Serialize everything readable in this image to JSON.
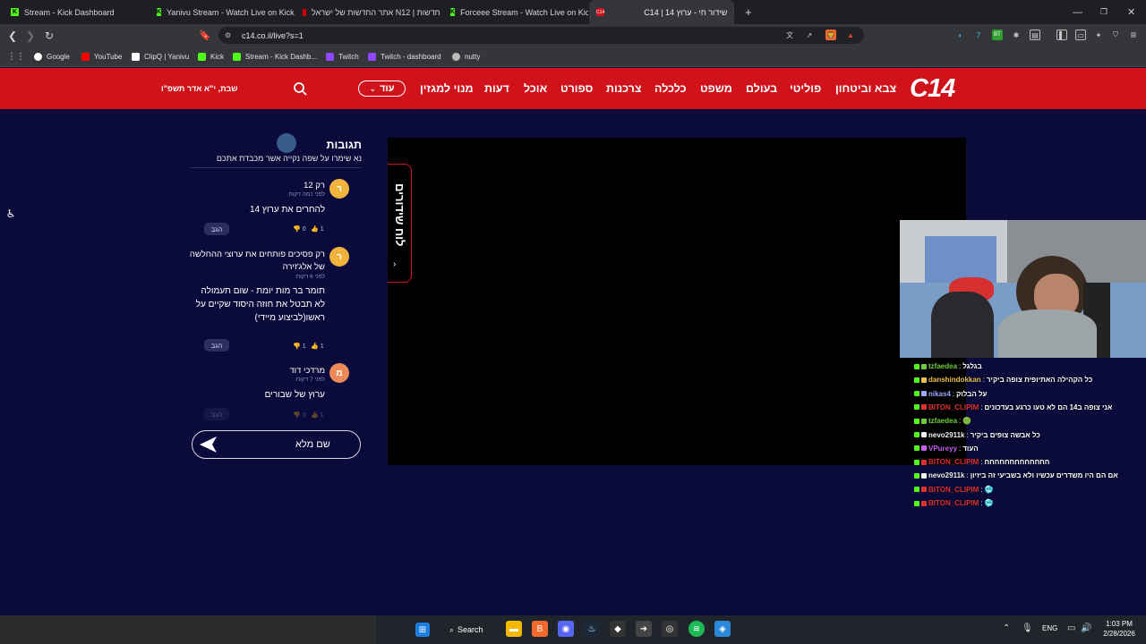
{
  "tabs": [
    {
      "title": "Stream - Kick Dashboard",
      "icon": "kick-icon"
    },
    {
      "title": "Yanivu Stream - Watch Live on Kick",
      "icon": "kick-icon"
    },
    {
      "title": "חדשות | N12 אתר החדשות של ישראל",
      "icon": "n12-icon"
    },
    {
      "title": "Forceee Stream - Watch Live on Kick",
      "icon": "kick-icon"
    },
    {
      "title": "שידור חי - ערוץ 14 | C14",
      "icon": "c14-icon"
    }
  ],
  "address": {
    "url": "c14.co.il/live?s=1"
  },
  "bookmarks": [
    {
      "label": "Google"
    },
    {
      "label": "YouTube"
    },
    {
      "label": "ClipQ | Yanivu"
    },
    {
      "label": "Kick"
    },
    {
      "label": "Stream - Kick Dashb..."
    },
    {
      "label": "Twitch"
    },
    {
      "label": "Twitch - dashboard"
    },
    {
      "label": "nutty"
    }
  ],
  "site": {
    "logo": "C14",
    "nav": [
      "צבא וביטחון",
      "פוליטי",
      "בעולם",
      "משפט",
      "כלכלה",
      "צרכנות",
      "ספורט",
      "אוכל",
      "דעות",
      "מנוי למגזין"
    ],
    "more": "עוד",
    "date": "שבת, י\"א אדר תשפ\"ו"
  },
  "schedule": {
    "label": "לוח שידורים"
  },
  "comments": {
    "title": "תגובות",
    "subtitle": "נא שימרו על שפה נקייה אשר מכבדת אתכם",
    "reply_label": "הגב",
    "items": [
      {
        "avatar": "ר",
        "name": "רק 12",
        "time": "לפני כמה דקות",
        "text": "להחרים את ערוץ 14",
        "likes": "1",
        "dislikes": "0"
      },
      {
        "avatar": "ר",
        "name": "רק פסיכים פותחים את ערוצי ההחלשה של אלג'זירה",
        "time": "לפני 6 דקות",
        "text": "תומר בר מות יומת - שום תעמולה לא תבטל את חוזה היסוד שקיים על ראשו(לביצוע מיידי)",
        "likes": "1",
        "dislikes": "1"
      },
      {
        "avatar": "מ",
        "name": "מרדכי דוד",
        "time": "לפני 7 דקות",
        "text": "ערוץ של שבורים",
        "likes": "1",
        "dislikes": "0"
      }
    ],
    "send_label": "שם מלא"
  },
  "chat": [
    {
      "user": "tzfaedea",
      "color": "#6dcc3c",
      "msg": "בגלגל"
    },
    {
      "user": "danshindokkan",
      "color": "#e8c14d",
      "msg": "כל הקהילה האתיופית צופה ביקיר"
    },
    {
      "user": "nikas4",
      "color": "#9aa7ff",
      "msg": "על הבלוק"
    },
    {
      "user": "BITON_CLIPIM",
      "color": "#e03030",
      "msg": "אני צופה ב14 הם לא טעו כרגע בעדכונים"
    },
    {
      "user": "tzfaedea",
      "color": "#6dcc3c",
      "msg": "🟢"
    },
    {
      "user": "nevo2911k",
      "color": "#f0f0f0",
      "msg": "כל אבשה צופים ביקיר"
    },
    {
      "user": "VPureyy",
      "color": "#c55cf2",
      "msg": "העוד"
    },
    {
      "user": "BITON_CLIPIM",
      "color": "#e03030",
      "msg": "חחחחחחחחחחחחח"
    },
    {
      "user": "nevo2911k",
      "color": "#f0f0f0",
      "msg": "אם הם היו משדרים עכשיו ולא בשביעי זה ביזיון"
    },
    {
      "user": "BITON_CLIPIM",
      "color": "#e03030",
      "msg": "🥶"
    },
    {
      "user": "BITON_CLIPIM",
      "color": "#e03030",
      "msg": "🥶"
    }
  ],
  "taskbar": {
    "search_label": "Search",
    "lang": "ENG",
    "time": "1:03 PM",
    "date": "2/28/2026"
  }
}
